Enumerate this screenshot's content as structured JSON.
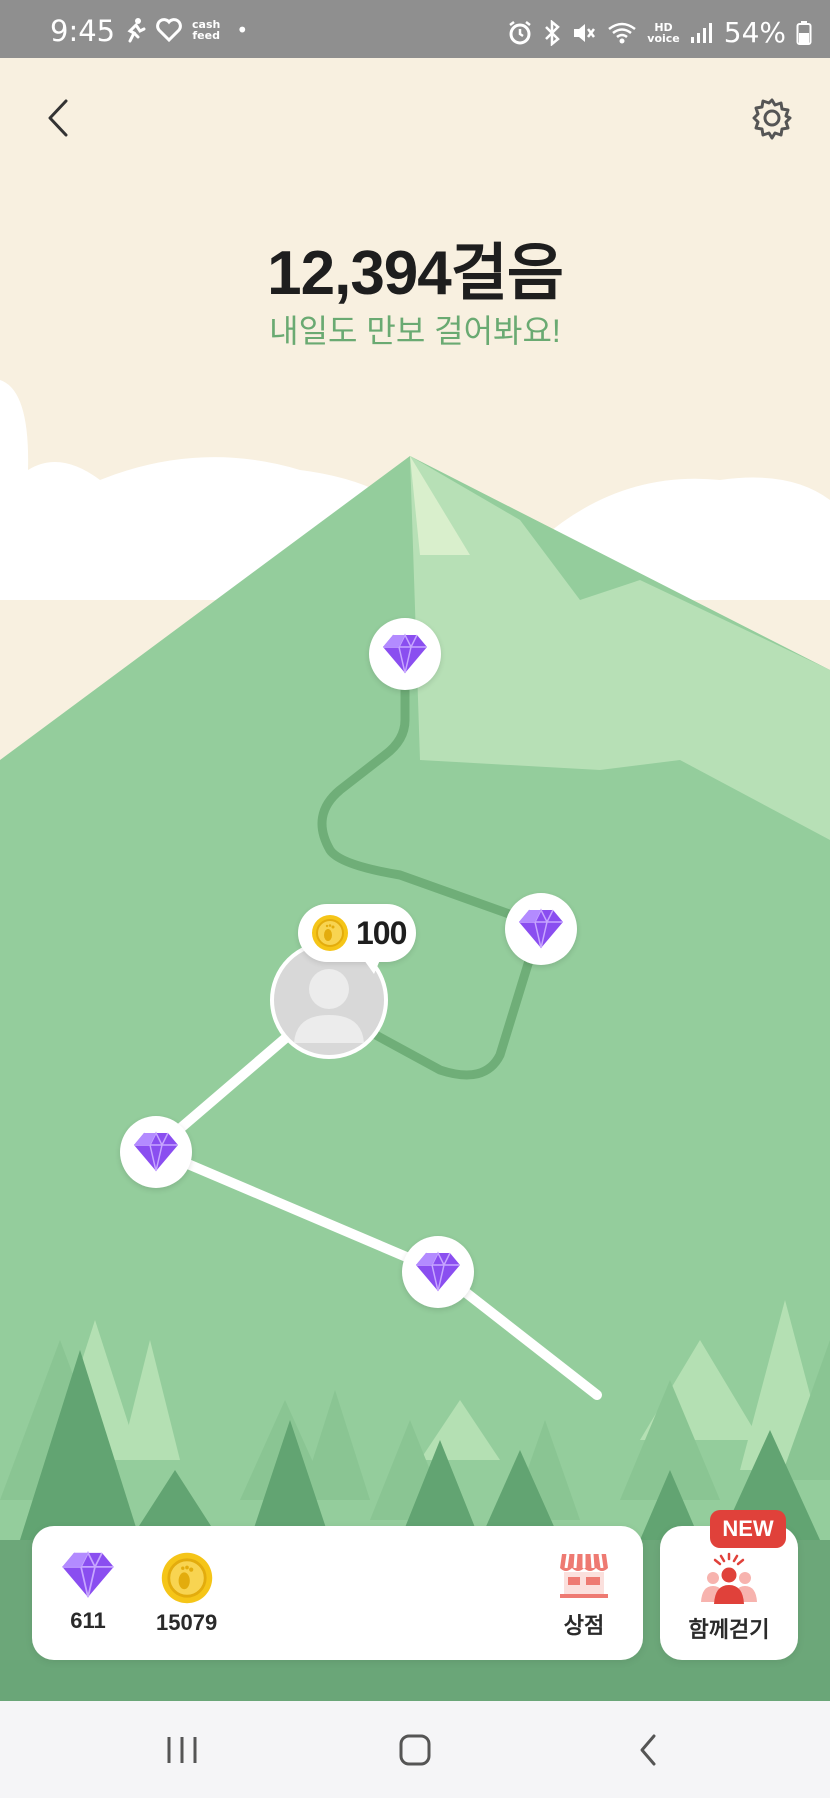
{
  "status_bar": {
    "time": "9:45",
    "cash_top": "cash",
    "cash_bottom": "feed",
    "hd_top": "HD",
    "hd_bottom": "voice",
    "battery": "54%",
    "icons": [
      "runner-icon",
      "heart-icon",
      "cashfeed-icon",
      "alarm-icon",
      "bluetooth-icon",
      "mute-icon",
      "wifi-icon",
      "signal-icon",
      "battery-icon"
    ]
  },
  "header": {
    "back_icon": "chevron-left-icon",
    "settings_icon": "gear-icon",
    "steps": "12,394걸음",
    "message": "내일도 만보 걸어봐요!"
  },
  "map": {
    "current_reward": "100",
    "reward_icon": "coin-icon",
    "node_icon": "gem-icon",
    "avatar_icon": "person-icon"
  },
  "wallet": {
    "gems": "611",
    "coins": "15079",
    "shop_label": "상점",
    "shop_icon": "store-icon"
  },
  "walk_together": {
    "label": "함께걷기",
    "badge": "NEW",
    "icon": "group-icon"
  },
  "nav": {
    "icons": [
      "recents-icon",
      "home-icon",
      "back-icon"
    ]
  },
  "colors": {
    "sky": "#f8f0e0",
    "mountain": "#94cd9c",
    "accent_green": "#6aaa72",
    "gem": "#8a4ef0",
    "coin": "#f5c518",
    "badge": "#e0413a"
  }
}
